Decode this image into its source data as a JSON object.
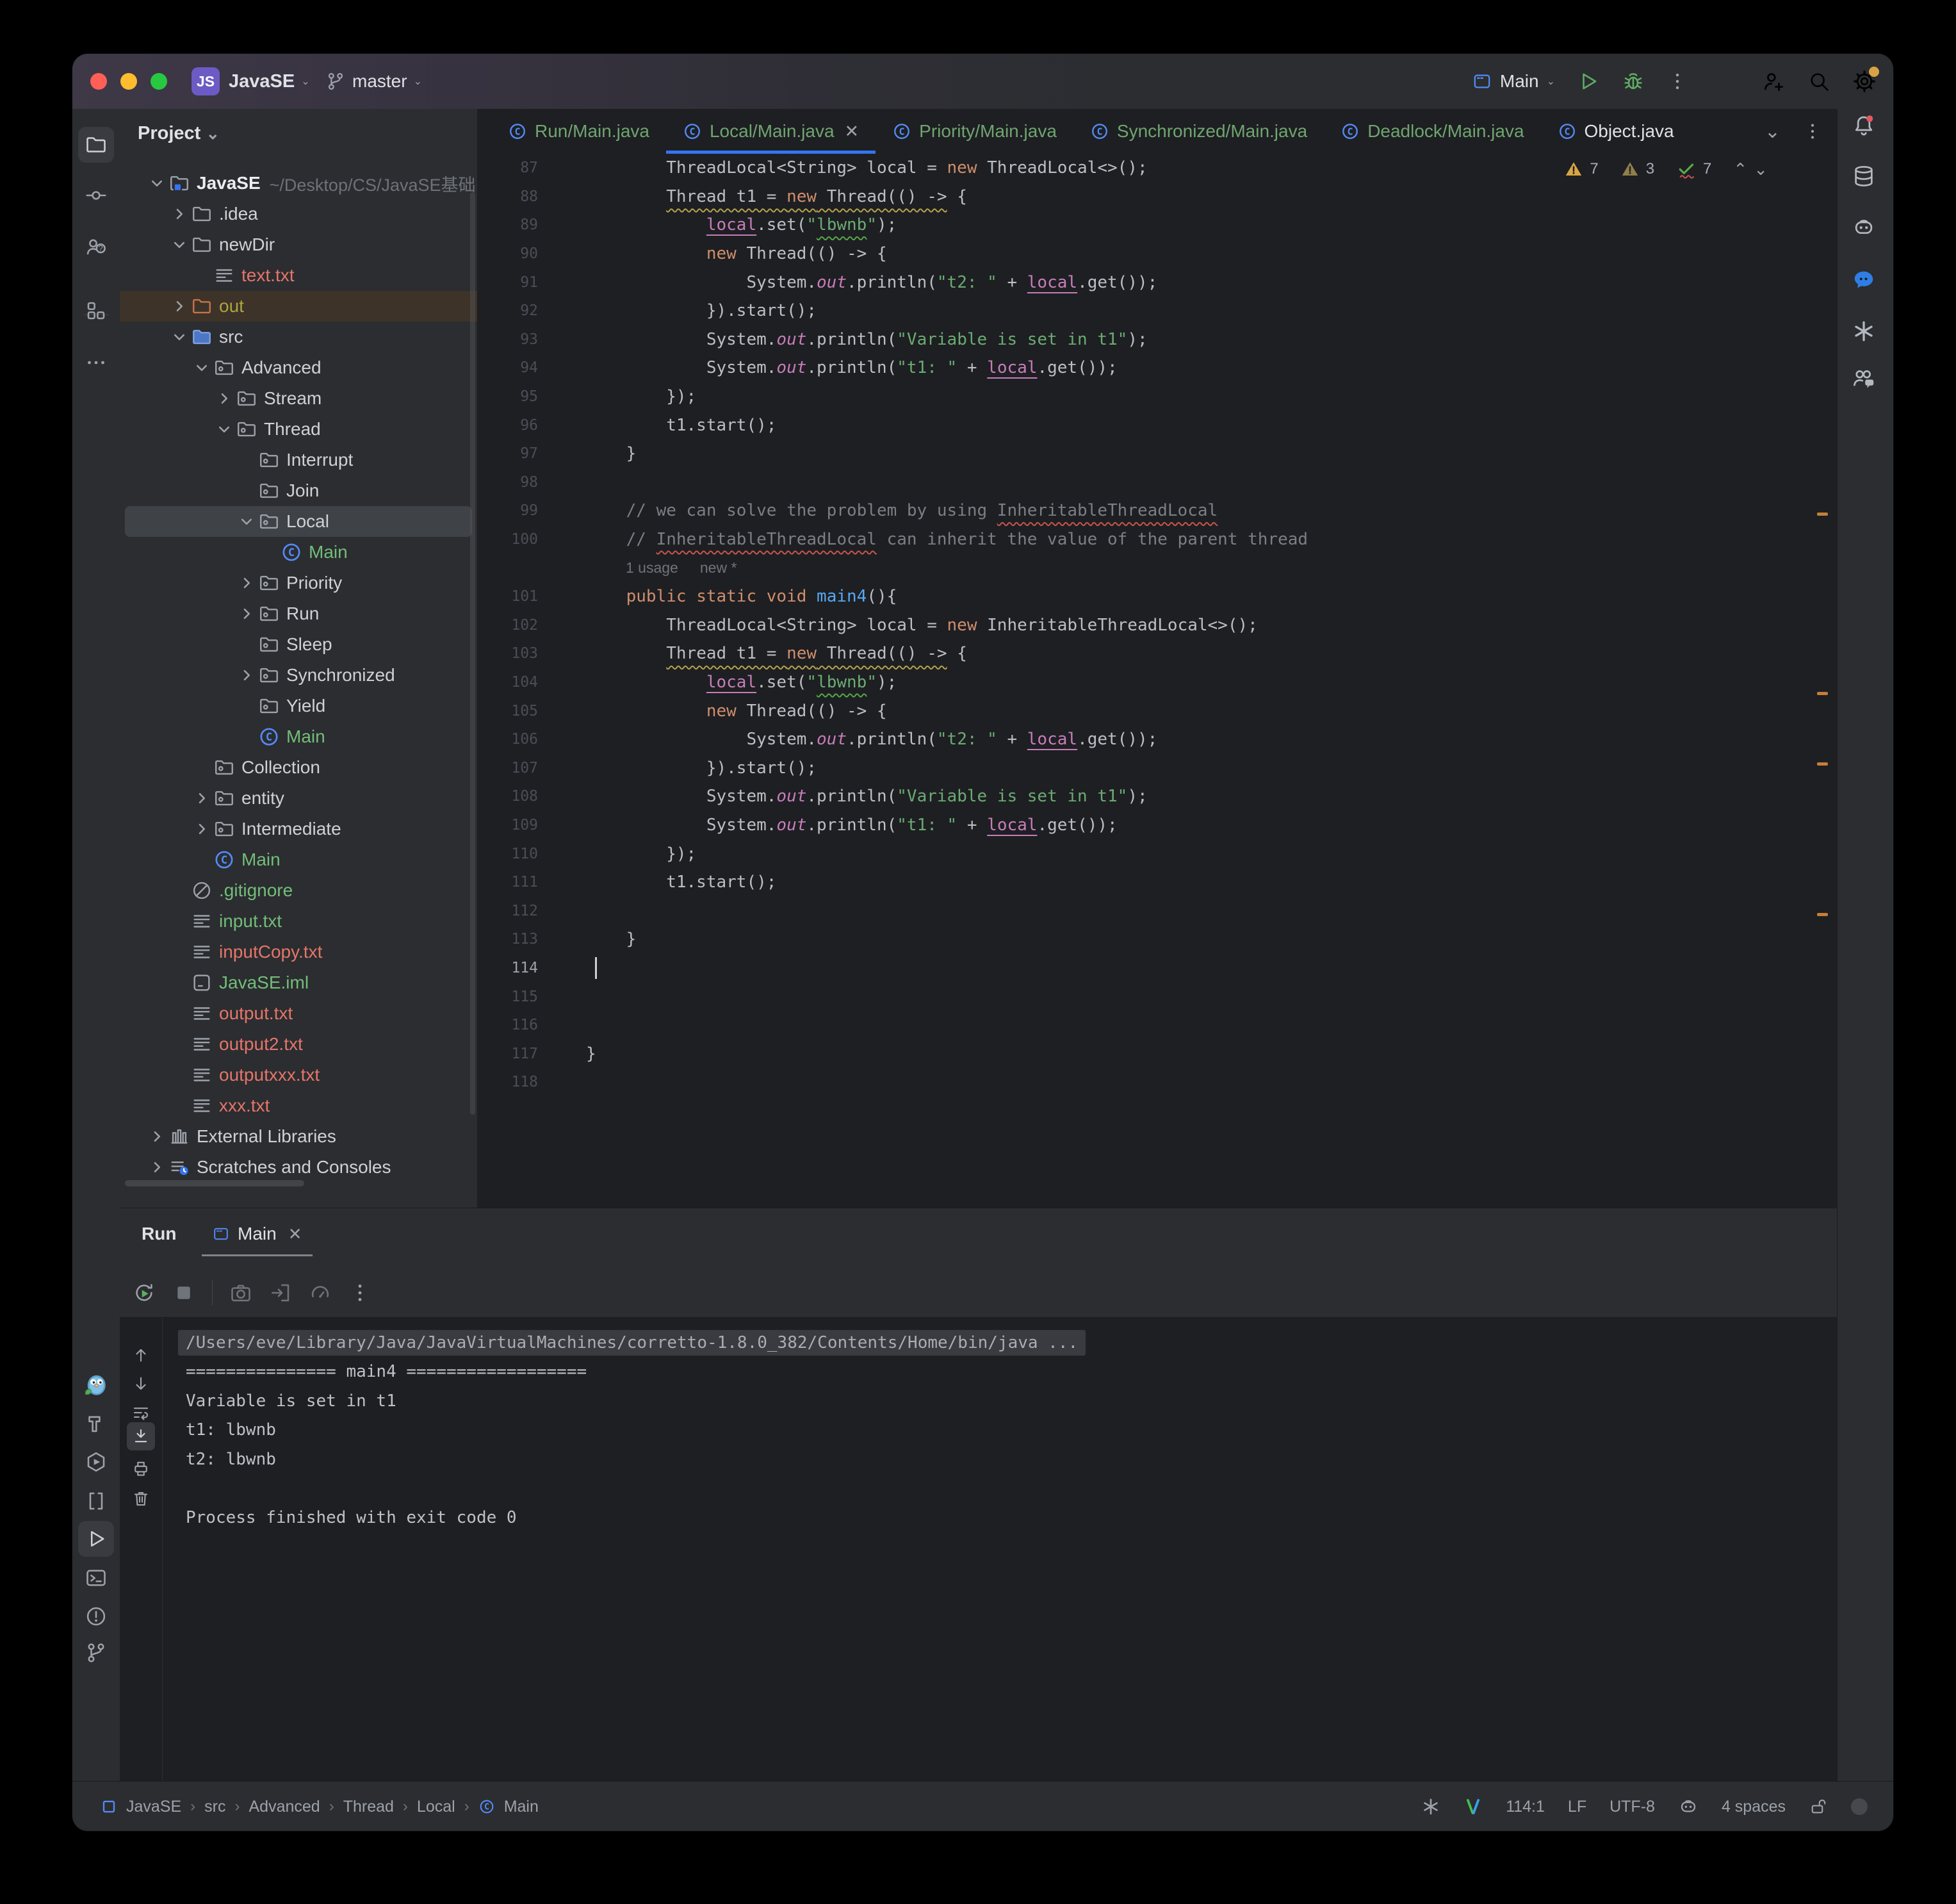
{
  "titlebar": {
    "app_initials": "JS",
    "project": "JavaSE",
    "branch": "master",
    "run_config": "Main"
  },
  "left_activity_bar": {
    "top": [
      {
        "name": "project-folder",
        "icon": "folder",
        "active": true
      },
      {
        "name": "commit",
        "icon": "commit"
      },
      {
        "name": "pull-requests",
        "icon": "prUsers"
      },
      {
        "name": "structure",
        "icon": "structure"
      },
      {
        "name": "more-tools",
        "icon": "moreH"
      }
    ],
    "bottom": [
      {
        "name": "go-plugin",
        "icon": "gopher"
      },
      {
        "name": "build",
        "icon": "hammer"
      },
      {
        "name": "services",
        "icon": "hexPlay"
      },
      {
        "name": "ai-brackets",
        "icon": "brackets"
      },
      {
        "name": "run",
        "icon": "playTri",
        "active": true
      },
      {
        "name": "terminal",
        "icon": "terminal"
      },
      {
        "name": "problems",
        "icon": "warn"
      },
      {
        "name": "git",
        "icon": "gitBranch"
      }
    ]
  },
  "right_activity_bar": {
    "icons": [
      {
        "name": "notifications",
        "icon": "bellDot"
      },
      {
        "name": "database",
        "icon": "db"
      },
      {
        "name": "github-copilot",
        "icon": "robot"
      },
      {
        "name": "chat-assistant",
        "icon": "chatBlue"
      },
      {
        "name": "openai-assistant",
        "icon": "openai"
      },
      {
        "name": "code-with-me",
        "icon": "peopleChat"
      }
    ]
  },
  "project_panel": {
    "header": "Project",
    "root_path": "~/Desktop/CS/JavaSE基础",
    "tree": [
      {
        "label": "JavaSE",
        "depth": 0,
        "icon": "folderRoot",
        "chevron": "down",
        "color": "root",
        "path": "~/Desktop/CS/JavaSE基础"
      },
      {
        "label": ".idea",
        "depth": 1,
        "icon": "folder",
        "chevron": "right"
      },
      {
        "label": "newDir",
        "depth": 1,
        "icon": "folder",
        "chevron": "down"
      },
      {
        "label": "text.txt",
        "depth": 2,
        "icon": "fileText",
        "color": "red"
      },
      {
        "label": "out",
        "depth": 1,
        "icon": "folderOut",
        "chevron": "right",
        "color": "olive",
        "highlighted": true
      },
      {
        "label": "src",
        "depth": 1,
        "icon": "folderSrc",
        "chevron": "down"
      },
      {
        "label": "Advanced",
        "depth": 2,
        "icon": "package",
        "chevron": "down"
      },
      {
        "label": "Stream",
        "depth": 3,
        "icon": "package",
        "chevron": "right"
      },
      {
        "label": "Thread",
        "depth": 3,
        "icon": "package",
        "chevron": "down"
      },
      {
        "label": "Interrupt",
        "depth": 4,
        "icon": "package"
      },
      {
        "label": "Join",
        "depth": 4,
        "icon": "package"
      },
      {
        "label": "Local",
        "depth": 4,
        "icon": "package",
        "chevron": "down",
        "selected": true
      },
      {
        "label": "Main",
        "depth": 5,
        "icon": "class",
        "color": "green"
      },
      {
        "label": "Priority",
        "depth": 4,
        "icon": "package",
        "chevron": "right"
      },
      {
        "label": "Run",
        "depth": 4,
        "icon": "package",
        "chevron": "right"
      },
      {
        "label": "Sleep",
        "depth": 4,
        "icon": "package"
      },
      {
        "label": "Synchronized",
        "depth": 4,
        "icon": "package",
        "chevron": "right"
      },
      {
        "label": "Yield",
        "depth": 4,
        "icon": "package"
      },
      {
        "label": "Main",
        "depth": 4,
        "icon": "class",
        "color": "green"
      },
      {
        "label": "Collection",
        "depth": 2,
        "icon": "package"
      },
      {
        "label": "entity",
        "depth": 2,
        "icon": "package",
        "chevron": "right"
      },
      {
        "label": "Intermediate",
        "depth": 2,
        "icon": "package",
        "chevron": "right"
      },
      {
        "label": "Main",
        "depth": 2,
        "icon": "class",
        "color": "green"
      },
      {
        "label": ".gitignore",
        "depth": 1,
        "icon": "ignored",
        "color": "green"
      },
      {
        "label": "input.txt",
        "depth": 1,
        "icon": "fileText",
        "color": "green"
      },
      {
        "label": "inputCopy.txt",
        "depth": 1,
        "icon": "fileText",
        "color": "red"
      },
      {
        "label": "JavaSE.iml",
        "depth": 1,
        "icon": "iml",
        "color": "green"
      },
      {
        "label": "output.txt",
        "depth": 1,
        "icon": "fileText",
        "color": "red"
      },
      {
        "label": "output2.txt",
        "depth": 1,
        "icon": "fileText",
        "color": "red"
      },
      {
        "label": "outputxxx.txt",
        "depth": 1,
        "icon": "fileText",
        "color": "red"
      },
      {
        "label": "xxx.txt",
        "depth": 1,
        "icon": "fileText",
        "color": "red"
      },
      {
        "label": "External Libraries",
        "depth": 0,
        "icon": "lib",
        "chevron": "right"
      },
      {
        "label": "Scratches and Consoles",
        "depth": 0,
        "icon": "scratch",
        "chevron": "right"
      }
    ]
  },
  "editor": {
    "tabs": [
      {
        "label": "Run/Main.java",
        "color": "green"
      },
      {
        "label": "Local/Main.java",
        "color": "green",
        "active": true,
        "closable": true
      },
      {
        "label": "Priority/Main.java",
        "color": "green"
      },
      {
        "label": "Synchronized/Main.java",
        "color": "green"
      },
      {
        "label": "Deadlock/Main.java",
        "color": "green"
      },
      {
        "label": "Object.java",
        "color": "white"
      }
    ],
    "inspections": {
      "warnings": "7",
      "weak_warnings": "3",
      "typos": "7"
    },
    "inlay": {
      "usages": "1 usage",
      "author": "new *"
    },
    "caret_line": 114,
    "lines": [
      {
        "n": 87,
        "segs": [
          [
            "p",
            "        ThreadLocal<String> local = "
          ],
          [
            "k",
            "new"
          ],
          [
            "p",
            " ThreadLocal<>();"
          ]
        ]
      },
      {
        "n": 88,
        "segs": [
          [
            "p",
            "        "
          ],
          [
            "yp",
            "Thread t1 = "
          ],
          [
            "yk",
            "new"
          ],
          [
            "yp",
            " Thread(() ->"
          ],
          [
            "p",
            " {"
          ]
        ]
      },
      {
        "n": 89,
        "segs": [
          [
            "p",
            "            "
          ],
          [
            "l",
            "local"
          ],
          [
            "p",
            ".set("
          ],
          [
            "s",
            "\""
          ],
          [
            "st",
            "lbwnb"
          ],
          [
            "s",
            "\""
          ],
          [
            "p",
            ");"
          ]
        ]
      },
      {
        "n": 90,
        "segs": [
          [
            "p",
            "            "
          ],
          [
            "k",
            "new"
          ],
          [
            "p",
            " Thread(() -> {"
          ]
        ]
      },
      {
        "n": 91,
        "segs": [
          [
            "p",
            "                System."
          ],
          [
            "f",
            "out"
          ],
          [
            "p",
            ".println("
          ],
          [
            "s",
            "\"t2: \""
          ],
          [
            "p",
            " + "
          ],
          [
            "l",
            "local"
          ],
          [
            "p",
            ".get());"
          ]
        ]
      },
      {
        "n": 92,
        "segs": [
          [
            "p",
            "            }).start();"
          ]
        ]
      },
      {
        "n": 93,
        "segs": [
          [
            "p",
            "            System."
          ],
          [
            "f",
            "out"
          ],
          [
            "p",
            ".println("
          ],
          [
            "s",
            "\"Variable is set in t1\""
          ],
          [
            "p",
            ");"
          ]
        ]
      },
      {
        "n": 94,
        "segs": [
          [
            "p",
            "            System."
          ],
          [
            "f",
            "out"
          ],
          [
            "p",
            ".println("
          ],
          [
            "s",
            "\"t1: \""
          ],
          [
            "p",
            " + "
          ],
          [
            "l",
            "local"
          ],
          [
            "p",
            ".get());"
          ]
        ]
      },
      {
        "n": 95,
        "segs": [
          [
            "p",
            "        });"
          ]
        ]
      },
      {
        "n": 96,
        "segs": [
          [
            "p",
            "        t1.start();"
          ]
        ]
      },
      {
        "n": 97,
        "segs": [
          [
            "p",
            "    }"
          ]
        ]
      },
      {
        "n": 98,
        "segs": []
      },
      {
        "n": 99,
        "segs": [
          [
            "c",
            "    // we can solve the problem by using "
          ],
          [
            "ce",
            "InheritableThreadLocal"
          ]
        ]
      },
      {
        "n": 100,
        "segs": [
          [
            "c",
            "    // "
          ],
          [
            "ce",
            "InheritableThreadLocal"
          ],
          [
            "c",
            " can inherit the value of the parent thread"
          ]
        ]
      },
      {
        "inlay": true
      },
      {
        "n": 101,
        "segs": [
          [
            "p",
            "    "
          ],
          [
            "k",
            "public static void "
          ],
          [
            "d",
            "main4"
          ],
          [
            "p",
            "(){"
          ]
        ]
      },
      {
        "n": 102,
        "segs": [
          [
            "p",
            "        ThreadLocal<String> local = "
          ],
          [
            "k",
            "new"
          ],
          [
            "p",
            " InheritableThreadLocal<>();"
          ]
        ]
      },
      {
        "n": 103,
        "segs": [
          [
            "p",
            "        "
          ],
          [
            "yp",
            "Thread t1 = "
          ],
          [
            "yk",
            "new"
          ],
          [
            "yp",
            " Thread(() ->"
          ],
          [
            "p",
            " {"
          ]
        ]
      },
      {
        "n": 104,
        "segs": [
          [
            "p",
            "            "
          ],
          [
            "l",
            "local"
          ],
          [
            "p",
            ".set("
          ],
          [
            "s",
            "\""
          ],
          [
            "st",
            "lbwnb"
          ],
          [
            "s",
            "\""
          ],
          [
            "p",
            ");"
          ]
        ]
      },
      {
        "n": 105,
        "segs": [
          [
            "p",
            "            "
          ],
          [
            "k",
            "new"
          ],
          [
            "p",
            " Thread(() -> {"
          ]
        ]
      },
      {
        "n": 106,
        "segs": [
          [
            "p",
            "                System."
          ],
          [
            "f",
            "out"
          ],
          [
            "p",
            ".println("
          ],
          [
            "s",
            "\"t2: \""
          ],
          [
            "p",
            " + "
          ],
          [
            "l",
            "local"
          ],
          [
            "p",
            ".get());"
          ]
        ]
      },
      {
        "n": 107,
        "segs": [
          [
            "p",
            "            }).start();"
          ]
        ]
      },
      {
        "n": 108,
        "segs": [
          [
            "p",
            "            System."
          ],
          [
            "f",
            "out"
          ],
          [
            "p",
            ".println("
          ],
          [
            "s",
            "\"Variable is set in t1\""
          ],
          [
            "p",
            ");"
          ]
        ]
      },
      {
        "n": 109,
        "segs": [
          [
            "p",
            "            System."
          ],
          [
            "f",
            "out"
          ],
          [
            "p",
            ".println("
          ],
          [
            "s",
            "\"t1: \""
          ],
          [
            "p",
            " + "
          ],
          [
            "l",
            "local"
          ],
          [
            "p",
            ".get());"
          ]
        ]
      },
      {
        "n": 110,
        "segs": [
          [
            "p",
            "        });"
          ]
        ]
      },
      {
        "n": 111,
        "segs": [
          [
            "p",
            "        t1.start();"
          ]
        ]
      },
      {
        "n": 112,
        "segs": []
      },
      {
        "n": 113,
        "segs": [
          [
            "p",
            "    }"
          ]
        ]
      },
      {
        "n": 114,
        "segs": [],
        "caret": true
      },
      {
        "n": 115,
        "segs": []
      },
      {
        "n": 116,
        "segs": []
      },
      {
        "n": 117,
        "segs": [
          [
            "p",
            "}"
          ]
        ]
      },
      {
        "n": 118,
        "segs": []
      }
    ],
    "scroll_marks_y": [
      630,
      910,
      1020,
      1255
    ]
  },
  "run_panel": {
    "title": "Run",
    "tab": "Main",
    "toolbar": [
      {
        "name": "rerun",
        "icon": "rerun"
      },
      {
        "name": "stop",
        "icon": "stop"
      },
      {
        "name": "separator"
      },
      {
        "name": "screenshot",
        "icon": "camera"
      },
      {
        "name": "export",
        "icon": "export"
      },
      {
        "name": "profiler",
        "icon": "gauge"
      },
      {
        "name": "more-options",
        "icon": "moreV"
      }
    ],
    "gutter": [
      {
        "name": "scroll-up",
        "icon": "arrowUp"
      },
      {
        "name": "scroll-down",
        "icon": "arrowDown"
      },
      {
        "name": "soft-wrap",
        "icon": "softWrap"
      },
      {
        "name": "scroll-to-end",
        "icon": "scrollEnd",
        "active": true
      },
      {
        "name": "print",
        "icon": "printer"
      },
      {
        "name": "clear-all",
        "icon": "trash"
      }
    ],
    "console": [
      {
        "text": "/Users/eve/Library/Java/JavaVirtualMachines/corretto-1.8.0_382/Contents/Home/bin/java ...",
        "hl": true
      },
      {
        "text": "=============== main4 =================="
      },
      {
        "text": "Variable is set in t1"
      },
      {
        "text": "t1: lbwnb"
      },
      {
        "text": "t2: lbwnb"
      },
      {
        "text": ""
      },
      {
        "text": "Process finished with exit code 0"
      }
    ]
  },
  "status_bar": {
    "breadcrumbs": [
      "JavaSE",
      "src",
      "Advanced",
      "Thread",
      "Local",
      "Main"
    ],
    "position": "114:1",
    "line_sep": "LF",
    "encoding": "UTF-8",
    "indent": "4 spaces"
  },
  "colors": {
    "accent": "#3574F0",
    "added_green": "#73BD79",
    "error_red": "#E5756A",
    "warning_mark": "#C57E39",
    "titlebar_purple": "#3E3847"
  }
}
